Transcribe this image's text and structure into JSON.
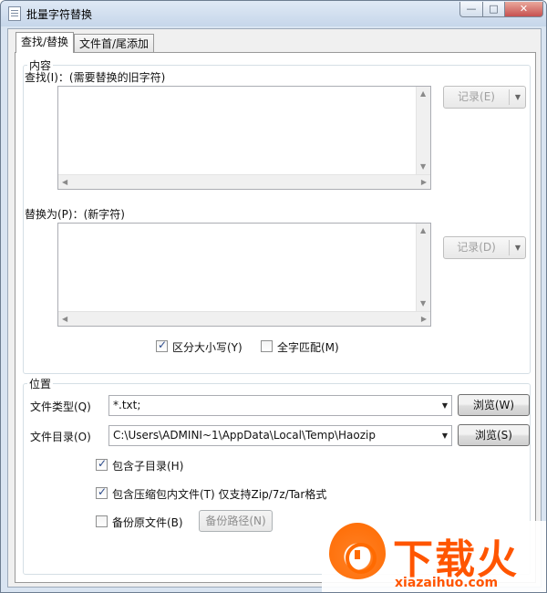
{
  "window": {
    "title": "批量字符替换",
    "minimize": "—",
    "maximize": "□",
    "close": "✕"
  },
  "tabs": [
    {
      "label": "查找/替换",
      "active": true
    },
    {
      "label": "文件首/尾添加",
      "active": false
    }
  ],
  "content_group": {
    "legend": "内容",
    "find_label": "查找(I)：(需要替换的旧字符)",
    "find_value": "",
    "find_history_button": "记录(E)",
    "replace_label": "替换为(P)：(新字符)",
    "replace_value": "",
    "replace_history_button": "记录(D)",
    "case_sensitive": {
      "label": "区分大小写(Y)",
      "checked": true
    },
    "whole_word": {
      "label": "全字匹配(M)",
      "checked": false
    }
  },
  "location_group": {
    "legend": "位置",
    "file_type_label": "文件类型(Q)",
    "file_type_value": "*.txt;",
    "browse_type_button": "浏览(W)",
    "directory_label": "文件目录(O)",
    "directory_value": "C:\\Users\\ADMINI~1\\AppData\\Local\\Temp\\Haozip",
    "browse_dir_button": "浏览(S)",
    "include_subdirs": {
      "label": "包含子目录(H)",
      "checked": true
    },
    "include_archives": {
      "label": "包含压缩包内文件(T) 仅支持Zip/7z/Tar格式",
      "checked": true
    },
    "backup_original": {
      "label": "备份原文件(B)",
      "checked": false
    },
    "backup_path_button": "备份路径(N)"
  },
  "watermark": {
    "brand": "下载火",
    "url": "xiazaihuo.com"
  },
  "colors": {
    "titlebar": "#c6d6ea",
    "accent": "#ff5500",
    "close_button": "#c75050"
  }
}
